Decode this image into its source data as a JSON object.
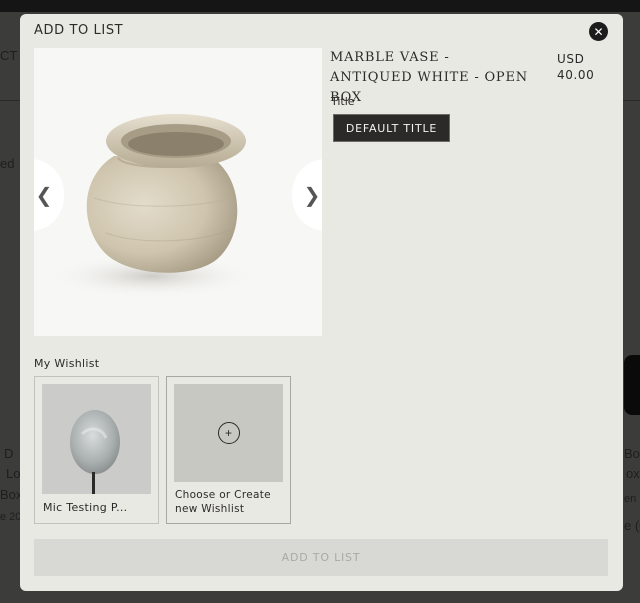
{
  "modal": {
    "title": "ADD TO LIST",
    "close_symbol": "✕"
  },
  "gallery": {
    "prev_symbol": "❮",
    "next_symbol": "❯",
    "image": "marble-vase-photo"
  },
  "product": {
    "name": "MARBLE VASE - ANTIQUED WHITE - OPEN BOX",
    "currency": "USD",
    "price": "40.00",
    "option_label": "Title",
    "option_value": "DEFAULT TITLE"
  },
  "wishlist": {
    "section_label": "My Wishlist",
    "items": [
      {
        "name": "Mic Testing P...",
        "image": "stone-spoon-photo"
      },
      {
        "name": "Choose or Create new Wishlist",
        "icon": "plus-circle-icon"
      }
    ]
  },
  "actions": {
    "add_label": "ADD TO LIST"
  },
  "background": {
    "snippets": [
      "CT",
      "ed",
      "D",
      "Lo",
      "Box",
      "e 20",
      "Box",
      "ox",
      "en",
      "e (0"
    ]
  },
  "colors": {
    "modal_bg": "#e9e9e4",
    "dark_button": "#2c2a28",
    "disabled_button": "#d8d8d5",
    "overlay": "#3c3c3a"
  }
}
